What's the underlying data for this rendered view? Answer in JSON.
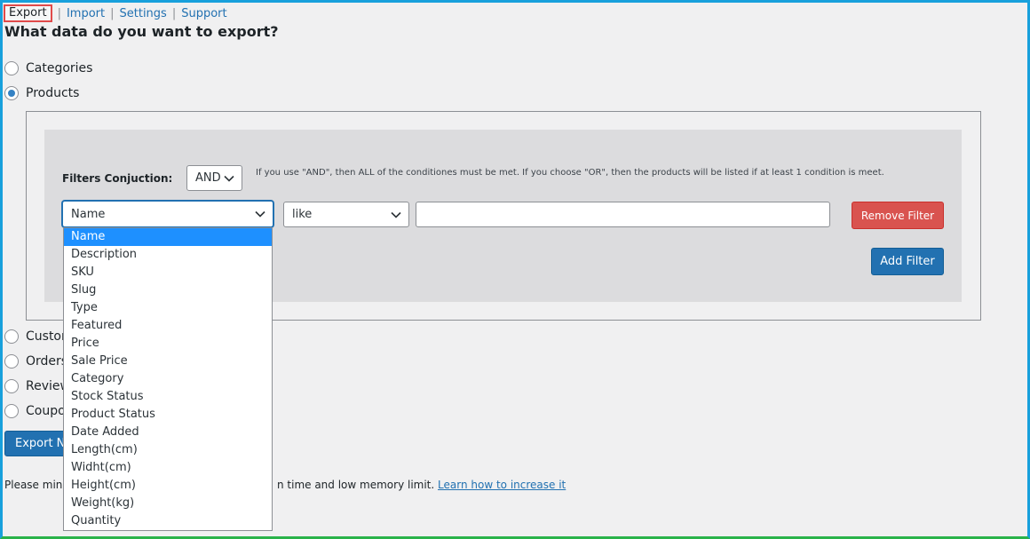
{
  "nav": {
    "active": "Export",
    "links": [
      "Import",
      "Settings",
      "Support"
    ],
    "separator": "|"
  },
  "heading": "What data do you want to export?",
  "types": [
    {
      "label": "Categories",
      "checked": false
    },
    {
      "label": "Products",
      "checked": true
    },
    {
      "label": "Custon",
      "checked": false
    },
    {
      "label": "Orders",
      "checked": false
    },
    {
      "label": "Review",
      "checked": false
    },
    {
      "label": "Coupo",
      "checked": false
    }
  ],
  "filters": {
    "conjunction_label": "Filters Conjuction:",
    "conjunction_value": "AND",
    "hint": "If you use \"AND\", then ALL of the conditiones must be met. If you choose \"OR\", then the products will be listed if at least 1 condition is meet.",
    "field_value": "Name",
    "operator_value": "like",
    "text_value": "",
    "remove_label": "Remove Filter",
    "add_label": "Add Filter"
  },
  "dropdown": {
    "selected": "Name",
    "options": [
      "Name",
      "Description",
      "SKU",
      "Slug",
      "Type",
      "Featured",
      "Price",
      "Sale Price",
      "Category",
      "Stock Status",
      "Product Status",
      "Date Added",
      "Length(cm)",
      "Widht(cm)",
      "Height(cm)",
      "Weight(kg)",
      "Quantity"
    ]
  },
  "export_button": "Export No",
  "note": {
    "text_start": "Please minc",
    "text_end": "n time and low memory limit.",
    "link": "Learn how to increase it"
  },
  "colors": {
    "accent": "#2271b1",
    "danger": "#d9534f",
    "frame_top": "#18a0dc",
    "frame_bottom": "#2ab34a",
    "selected_option": "#1e90ff"
  }
}
